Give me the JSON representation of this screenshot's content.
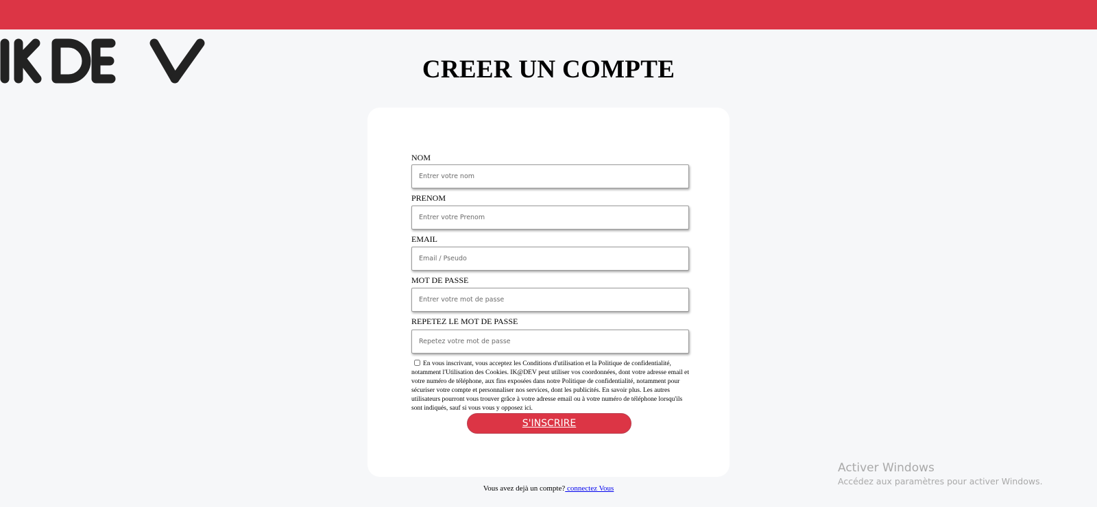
{
  "brand": {
    "logo_text": "IKDEV",
    "accent_color": "#dc3545"
  },
  "page_title": "CREER UN COMPTE",
  "form": {
    "fields": [
      {
        "label": "NOM",
        "placeholder": "Entrer votre nom",
        "value": ""
      },
      {
        "label": "PRENOM",
        "placeholder": "Entrer votre Prenom",
        "value": ""
      },
      {
        "label": "EMAIL",
        "placeholder": "Email / Pseudo",
        "value": ""
      },
      {
        "label": "MOT DE PASSE",
        "placeholder": "Entrer votre mot de passe",
        "value": ""
      },
      {
        "label": "REPETEZ LE MOT DE PASSE",
        "placeholder": "Repetez votre mot de passe",
        "value": ""
      }
    ],
    "terms_checked": false,
    "terms_text": "En vous inscrivant, vous acceptez les Conditions d'utilisation et la Politique de confidentialité, notamment l'Utilisation des Cookies. IK@DEV peut utiliser vos coordonnées, dont votre adresse email et votre numéro de téléphone, aux fins exposées dans notre Politique de confidentialité, notamment pour sécuriser votre compte et personnaliser nos services, dont les publicités. En savoir plus. Les autres utilisateurs pourront vous trouver grâce à votre adresse email ou à votre numéro de téléphone lorsqu'ils sont indiqués, sauf si vous vous y opposez ici.",
    "submit_label": "S'INSCRIRE"
  },
  "footer": {
    "prompt": "Vous avez dejà un compte?",
    "login_link": " connectez Vous"
  },
  "watermark": {
    "title": "Activer Windows",
    "subtitle": "Accédez aux paramètres pour activer Windows."
  }
}
